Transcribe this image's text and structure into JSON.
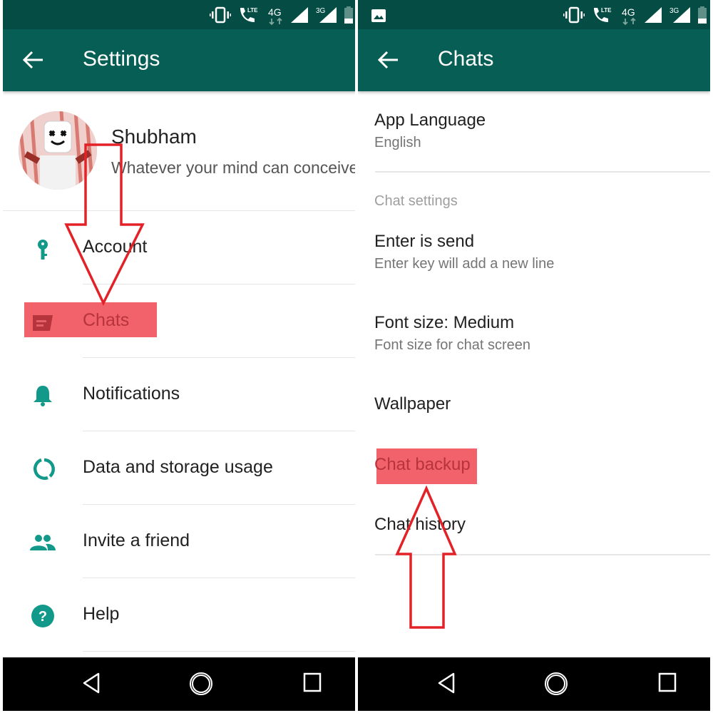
{
  "colors": {
    "statusbar": "#054d44",
    "appbar": "#075e54",
    "accent": "#009688",
    "highlight": "#f05a62",
    "annotation_arrow": "#e32228"
  },
  "status_icons": [
    "vibrate-icon",
    "lte-call-icon",
    "4g-icon",
    "signal-icon",
    "3g-signal-icon",
    "battery-icon"
  ],
  "status_labels": {
    "lte": "LTE",
    "g4": "4G",
    "g3": "3G"
  },
  "left": {
    "title": "Settings",
    "profile": {
      "name": "Shubham",
      "status": "Whatever your mind can conceive"
    },
    "items": [
      {
        "label": "Account",
        "icon": "key-icon"
      },
      {
        "label": "Chats",
        "icon": "chat-icon",
        "highlighted": true
      },
      {
        "label": "Notifications",
        "icon": "bell-icon"
      },
      {
        "label": "Data and storage usage",
        "icon": "data-usage-icon"
      },
      {
        "label": "Invite a friend",
        "icon": "people-icon"
      },
      {
        "label": "Help",
        "icon": "help-icon"
      }
    ]
  },
  "right": {
    "title": "Chats",
    "app_language": {
      "title": "App Language",
      "value": "English"
    },
    "section_header": "Chat settings",
    "items": [
      {
        "title": "Enter is send",
        "summary": "Enter key will add a new line"
      },
      {
        "title": "Font size: Medium",
        "summary": "Font size for chat screen"
      },
      {
        "title": "Wallpaper"
      },
      {
        "title": "Chat backup",
        "highlighted": true
      },
      {
        "title": "Chat history"
      }
    ]
  },
  "nav": {
    "buttons": [
      "back-nav-icon",
      "home-nav-icon",
      "recents-nav-icon"
    ]
  }
}
